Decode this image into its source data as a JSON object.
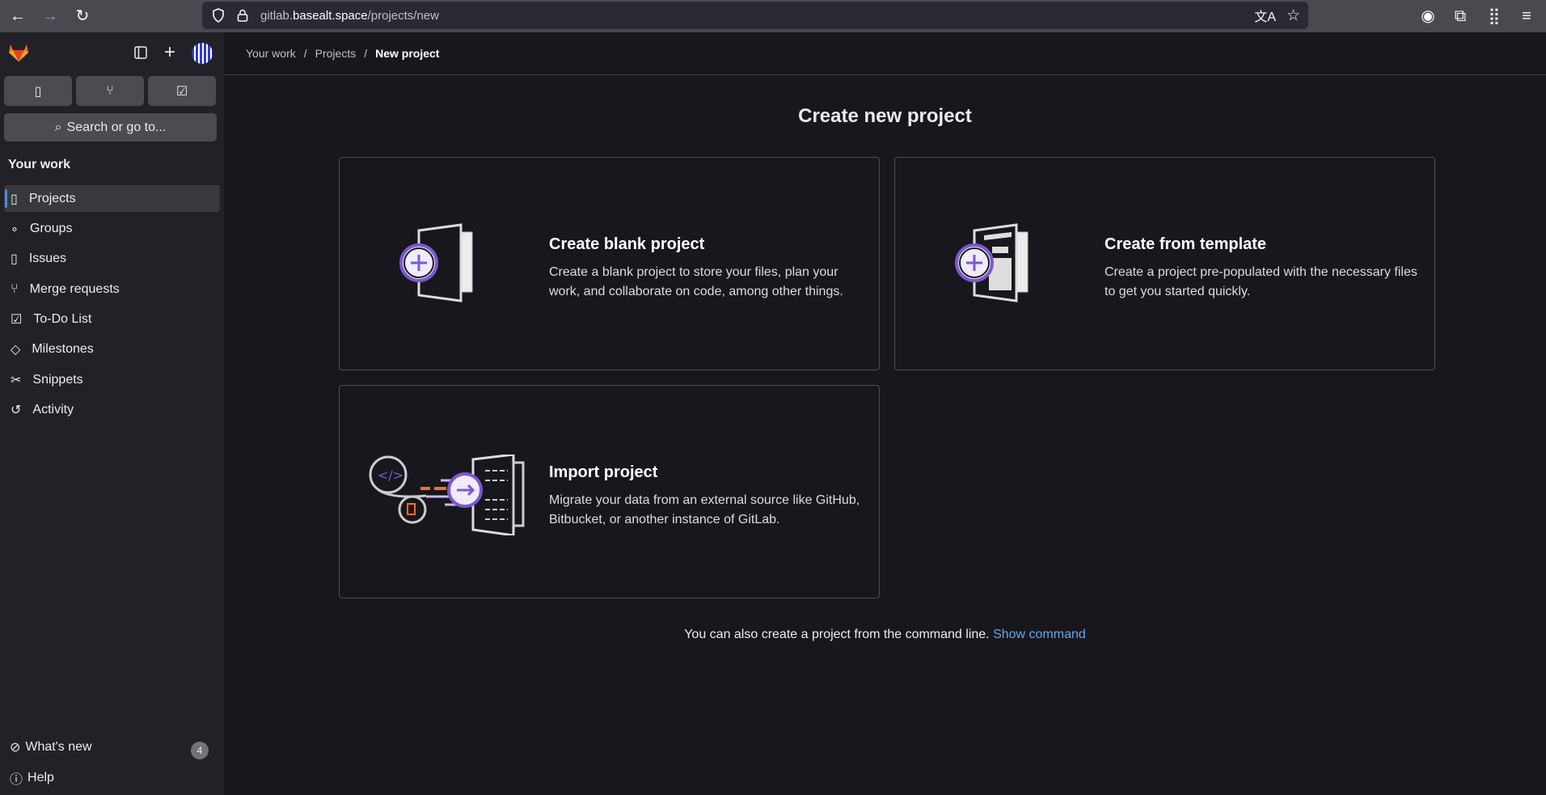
{
  "browser": {
    "url_host_prefix": "gitlab.",
    "url_host": "basealt.space",
    "url_path": "/projects/new"
  },
  "sidebar": {
    "search_label": "Search or go to...",
    "section": "Your work",
    "items": [
      {
        "label": "Projects",
        "icon": "project-icon"
      },
      {
        "label": "Groups",
        "icon": "group-icon"
      },
      {
        "label": "Issues",
        "icon": "issues-icon"
      },
      {
        "label": "Merge requests",
        "icon": "merge-request-icon"
      },
      {
        "label": "To-Do List",
        "icon": "todo-icon"
      },
      {
        "label": "Milestones",
        "icon": "milestone-icon"
      },
      {
        "label": "Snippets",
        "icon": "snippet-icon"
      },
      {
        "label": "Activity",
        "icon": "history-icon"
      }
    ],
    "whats_new": "What's new",
    "whats_new_count": "4",
    "help": "Help"
  },
  "breadcrumb": {
    "items": [
      "Your work",
      "Projects"
    ],
    "current": "New project"
  },
  "main": {
    "title": "Create new project",
    "cards": [
      {
        "title": "Create blank project",
        "desc": "Create a blank project to store your files, plan your work, and collaborate on code, among other things."
      },
      {
        "title": "Create from template",
        "desc": "Create a project pre-populated with the necessary files to get you started quickly."
      },
      {
        "title": "Import project",
        "desc": "Migrate your data from an external source like GitHub, Bitbucket, or another instance of GitLab."
      }
    ],
    "footer_text": "You can also create a project from the command line.",
    "footer_link": "Show command"
  },
  "colors": {
    "accent": "#7b58cf",
    "link": "#63a6e9",
    "bg": "#18171d"
  }
}
